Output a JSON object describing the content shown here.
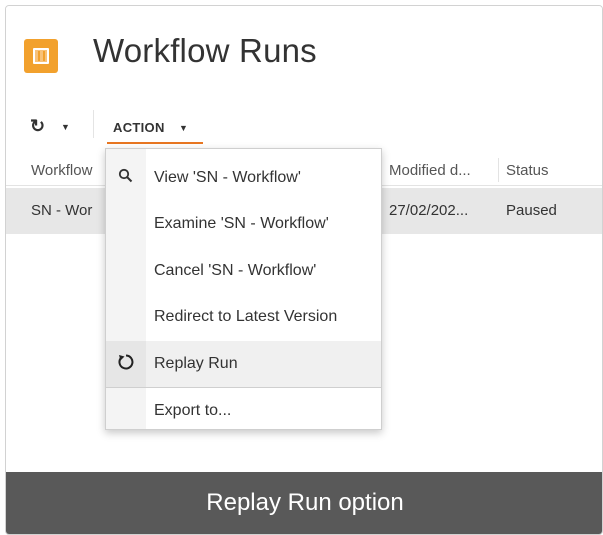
{
  "page": {
    "title": "Workflow Runs"
  },
  "toolbar": {
    "refresh_icon": "refresh-icon",
    "action_label": "ACTION",
    "accent_color": "#e87722"
  },
  "grid": {
    "columns": [
      "Workflow",
      "Modified d...",
      "Status"
    ],
    "rows": [
      {
        "workflow": "SN - Wor",
        "modified": "27/02/202...",
        "status": "Paused"
      }
    ]
  },
  "menu": {
    "items": [
      {
        "label": "View 'SN - Workflow'",
        "icon": "search-icon"
      },
      {
        "label": "Examine 'SN - Workflow'",
        "icon": ""
      },
      {
        "label": "Cancel 'SN - Workflow'",
        "icon": ""
      },
      {
        "label": "Redirect to Latest Version",
        "icon": ""
      },
      {
        "label": "Replay Run",
        "icon": "replay-icon",
        "highlighted": true
      },
      {
        "label": "Export to...",
        "icon": ""
      }
    ]
  },
  "caption": {
    "text": "Replay Run option"
  },
  "colors": {
    "app_icon": "#f2a12d",
    "caption_bg": "#595959",
    "selected_row": "#e7e7e7"
  }
}
